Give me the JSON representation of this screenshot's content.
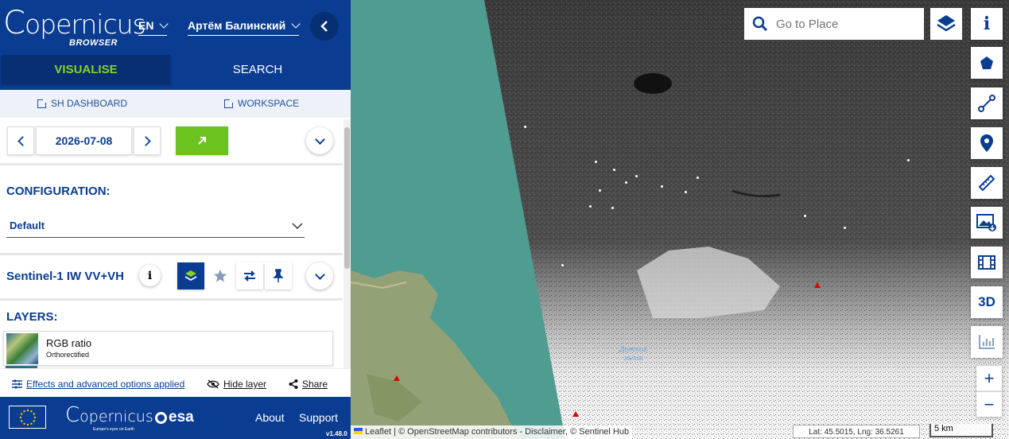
{
  "header": {
    "logo_text": "opernicus",
    "logo_sub": "BROWSER",
    "language": "EN",
    "user": "Артём Балинский"
  },
  "tabs": [
    {
      "label": "VISUALISE"
    },
    {
      "label": "SEARCH"
    }
  ],
  "links": {
    "dashboard": "SH DASHBOARD",
    "workspace": "WORKSPACE"
  },
  "date": {
    "value": "2026-07-08"
  },
  "configuration": {
    "title": "CONFIGURATION:",
    "selected": "Default"
  },
  "collection": {
    "name": "Sentinel-1 IW VV+VH"
  },
  "layers": {
    "title": "LAYERS:",
    "items": [
      {
        "name": "RGB ratio",
        "subtitle": "Orthorectified"
      }
    ]
  },
  "effects": {
    "label": "Effects and advanced options applied",
    "hide": "Hide layer",
    "share": "Share"
  },
  "footer": {
    "about": "About",
    "support": "Support",
    "version": "v1.48.0",
    "esa": "esa",
    "copernicus": "opernicus",
    "tagline": "Europe's eyes on Earth"
  },
  "map": {
    "search_placeholder": "Go to Place",
    "attribution": "Leaflet | © OpenStreetMap contributors - Disclaimer, © Sentinel Hub",
    "coords": "Lat: 45.5015, Lng: 36.5261",
    "scale": "5 km",
    "place_label_1": "Динской",
    "place_label_2": "залив",
    "threed": "3D"
  },
  "colors": {
    "brand": "#0a3d91",
    "accent": "#8ad11f"
  }
}
